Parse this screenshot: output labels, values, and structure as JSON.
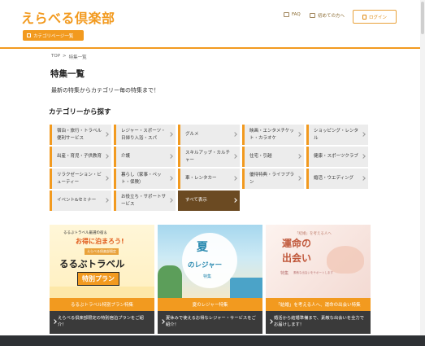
{
  "header": {
    "logo": "えらべる倶楽部",
    "category_button": "カテゴリページ一覧",
    "faq": "FAQ",
    "first_time": "初めての方へ",
    "login": "ログイン"
  },
  "breadcrumb": {
    "home": "TOP",
    "sep": ">",
    "current": "特集一覧"
  },
  "page_title": "特集一覧",
  "lead": "最新の特集からカテゴリー毎の特集まで！",
  "category_section_title": "カテゴリーから探す",
  "categories": [
    "宿泊・旅行・トラベル便利サービス",
    "レジャー・スポーツ・日帰り入浴・スパ",
    "グルメ",
    "映画・エンタメチケット・カラオケ",
    "ショッピング・レンタル",
    "出産・育児・子供教育",
    "介護",
    "スキルアップ・カルチャー",
    "住宅・引越",
    "健康・スポーツクラブ",
    "リラクゼーション・ビューティー",
    "暮らし（家事・ペット・保険）",
    "車・レンタカー",
    "優待特典・ライフプラン",
    "婚活・ウエディング",
    "イベント&セミナー",
    "お役立ち・サポートサービス"
  ],
  "show_all": "すべて表示",
  "features": [
    {
      "image": {
        "line1": "るるぶトラベル厳選の宿＆",
        "line2": "お得に泊まろう!",
        "badge": "えらべる倶楽部限定",
        "brand": "るるぶトラベル",
        "plan": "特別プラン"
      },
      "title": "るるぶトラベル特別プラン特集",
      "desc": "えらべる倶楽部限定の特別宿泊プランをご紹介！"
    },
    {
      "image": {
        "big": "夏",
        "sub": "のレジャー",
        "small": "特集"
      },
      "title": "夏のレジャー特集",
      "desc": "夏休みで使えるお得なレジャー・サービスをご紹介！"
    },
    {
      "image": {
        "top": "「結婚」を考える人へ",
        "line1": "運命の",
        "line2": "出会い",
        "tag": "特集",
        "note": "素敵な出会いをサポートします"
      },
      "title": "「結婚」を考える人へ、運命の出会い特集",
      "desc": "婚活から結婚準備まで、素敵な出会いを全力でお届けします！"
    }
  ]
}
